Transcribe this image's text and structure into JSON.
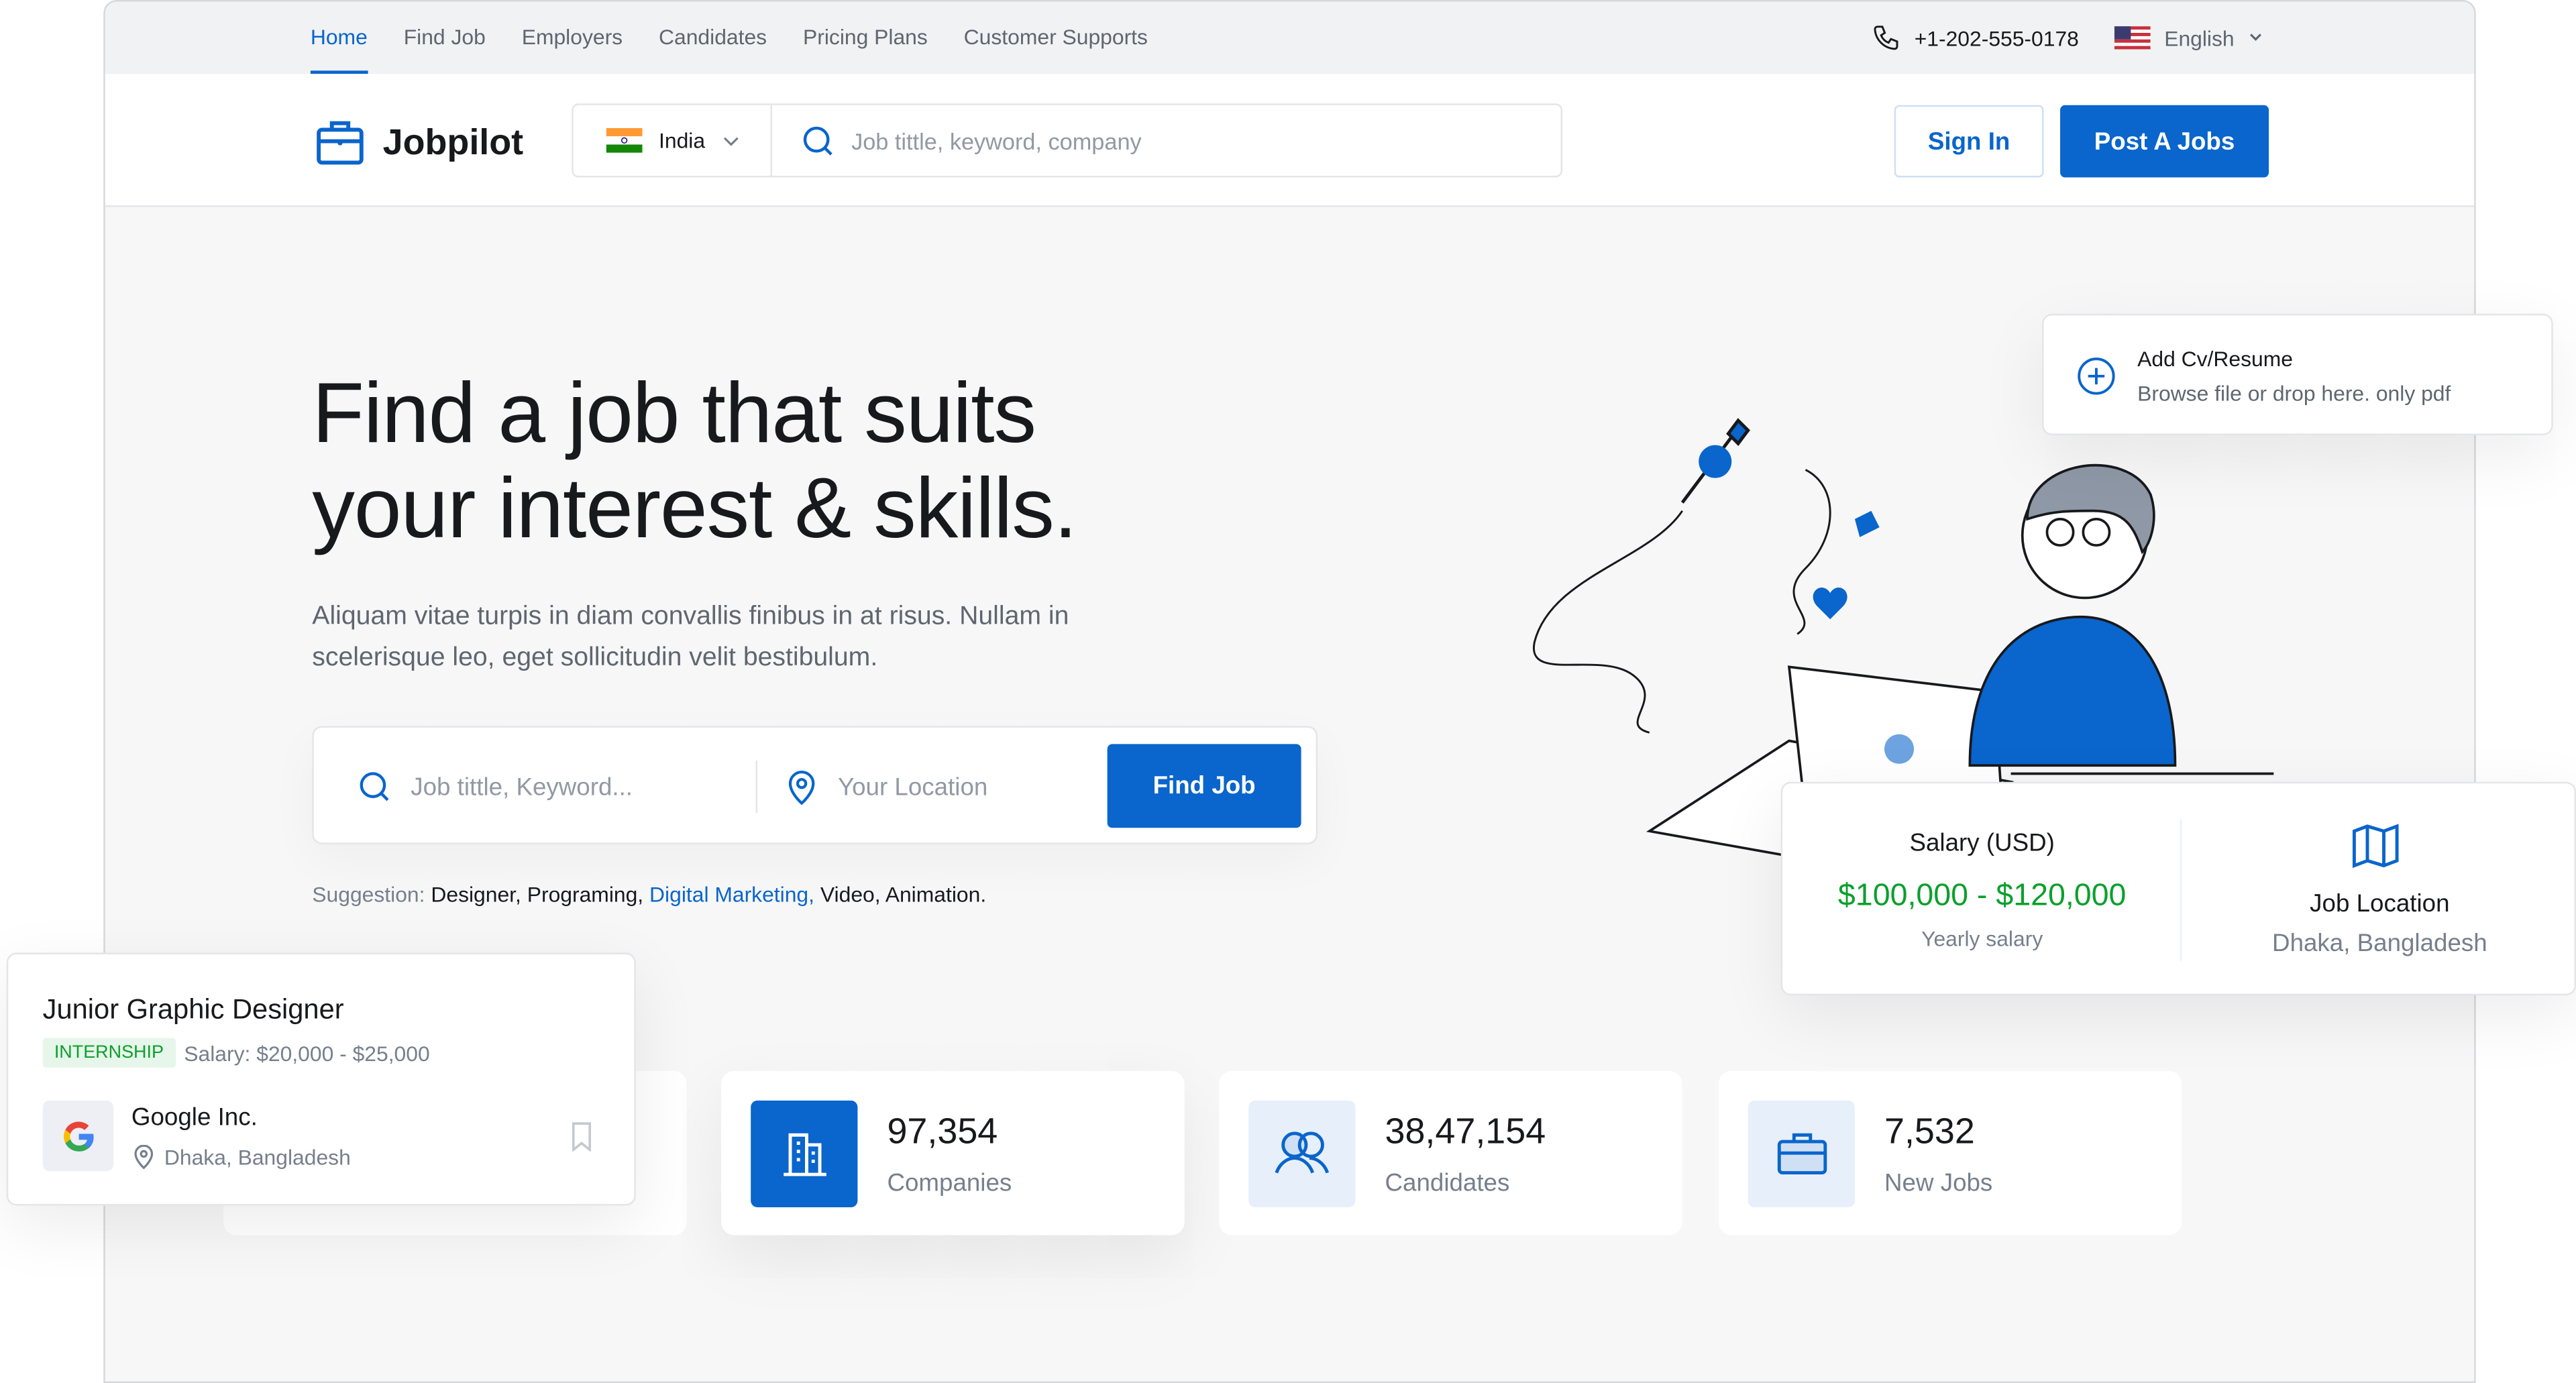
{
  "topnav": {
    "items": [
      "Home",
      "Find Job",
      "Employers",
      "Candidates",
      "Pricing Plans",
      "Customer Supports"
    ],
    "active": "Home",
    "phone": "+1-202-555-0178",
    "language": "English"
  },
  "header": {
    "logo": "Jobpilot",
    "country": "India",
    "search_placeholder": "Job tittle, keyword, company",
    "sign_in": "Sign In",
    "post_job": "Post A Jobs"
  },
  "hero": {
    "title_line1": "Find a job that suits",
    "title_line2": "your interest & skills.",
    "description": "Aliquam vitae turpis in diam convallis finibus in at risus. Nullam in scelerisque leo, eget sollicitudin velit bestibulum.",
    "search": {
      "keyword_placeholder": "Job tittle, Keyword...",
      "location_placeholder": "Your Location",
      "button": "Find Job"
    },
    "suggestion": {
      "label": "Suggestion:",
      "items": [
        "Designer,",
        "Programing,",
        "Digital Marketing,",
        "Video,",
        "Animation."
      ],
      "highlighted": "Digital Marketing,"
    }
  },
  "stats": [
    {
      "value": "97,354",
      "label": "Companies",
      "icon": "building-icon"
    },
    {
      "value": "38,47,154",
      "label": "Candidates",
      "icon": "users-icon"
    },
    {
      "value": "7,532",
      "label": "New Jobs",
      "icon": "briefcase-icon"
    }
  ],
  "cv_card": {
    "title": "Add Cv/Resume",
    "subtitle": "Browse file or drop here. only pdf"
  },
  "salary_card": {
    "title": "Salary (USD)",
    "range": "$100,000 - $120,000",
    "note": "Yearly salary",
    "location_title": "Job Location",
    "location": "Dhaka, Bangladesh"
  },
  "job_card": {
    "title": "Junior Graphic Designer",
    "badge": "INTERNSHIP",
    "salary": "Salary: $20,000 - $25,000",
    "company": "Google Inc.",
    "location": "Dhaka, Bangladesh"
  },
  "colors": {
    "primary": "#0a65cc",
    "success": "#0ba02c",
    "badge_bg": "#e7f6ea"
  }
}
